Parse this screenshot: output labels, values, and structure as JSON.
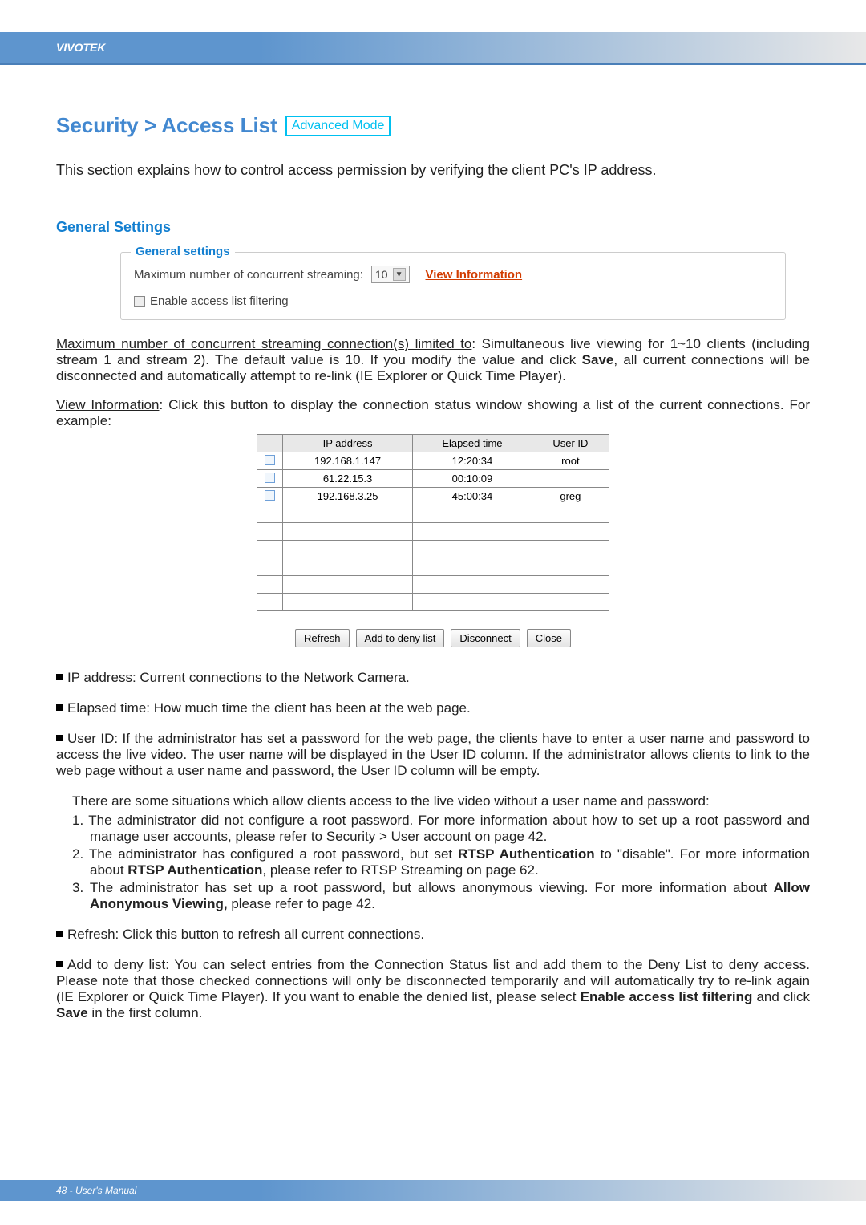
{
  "header": {
    "brand": "VIVOTEK"
  },
  "title": {
    "text": "Security >  Access List",
    "badge": "Advanced Mode"
  },
  "intro": "This section explains how to control access permission by verifying the client PC's IP address.",
  "section": {
    "heading": "General Settings"
  },
  "settings_box": {
    "legend": "General settings",
    "max_label": "Maximum number of concurrent streaming:",
    "max_value": "10",
    "view_info": "View Information",
    "enable_filtering": "Enable access list filtering"
  },
  "para_max": {
    "label": "Maximum number of concurrent streaming connection(s) limited to",
    "text": ": Simultaneous live viewing for 1~10 clients (including stream 1 and stream 2). The default value is 10. If you modify the value and click ",
    "save": "Save",
    "text2": ", all current connections will be disconnected and automatically attempt to re-link (IE Explorer or Quick Time Player)."
  },
  "para_view": {
    "label": "View Information",
    "text": ": Click this button to display the connection status window showing a list of the current connections. For example:"
  },
  "conn_table": {
    "headers": [
      "",
      "IP address",
      "Elapsed time",
      "User ID"
    ],
    "rows": [
      {
        "checked": false,
        "ip": "192.168.1.147",
        "elapsed": "12:20:34",
        "user": "root"
      },
      {
        "checked": false,
        "ip": "61.22.15.3",
        "elapsed": "00:10:09",
        "user": ""
      },
      {
        "checked": false,
        "ip": "192.168.3.25",
        "elapsed": "45:00:34",
        "user": "greg"
      },
      {
        "checked": null,
        "ip": "",
        "elapsed": "",
        "user": ""
      },
      {
        "checked": null,
        "ip": "",
        "elapsed": "",
        "user": ""
      },
      {
        "checked": null,
        "ip": "",
        "elapsed": "",
        "user": ""
      },
      {
        "checked": null,
        "ip": "",
        "elapsed": "",
        "user": ""
      },
      {
        "checked": null,
        "ip": "",
        "elapsed": "",
        "user": ""
      },
      {
        "checked": null,
        "ip": "",
        "elapsed": "",
        "user": ""
      }
    ],
    "buttons": {
      "refresh": "Refresh",
      "add_deny": "Add to deny list",
      "disconnect": "Disconnect",
      "close": "Close"
    }
  },
  "bullets": {
    "ip_addr": "IP address: Current connections to the Network Camera.",
    "elapsed": "Elapsed time: How much time the client has been at the web page.",
    "user_id": {
      "p1": "User ID: If the administrator has set a password for the web page, the clients have to enter a user name and password to access the live video. The user name will be displayed in the User ID column. If  the administrator allows clients to link to the web page without a user name and password, the User ID column will be empty.",
      "p2": "There are some situations which allow clients access to the live video without a user name and password:",
      "n1a": "1. The administrator did not configure a root password. For more information about how to set up a root password and manage user accounts, please refer to Security > User account on page 42.",
      "n2a": "2. The administrator has configured a root password, but set ",
      "n2b": "RTSP Authentication",
      "n2c": " to \"disable\". For more information about ",
      "n2d": "RTSP Authentication",
      "n2e": ", please refer to RTSP Streaming on page 62.",
      "n3a": "3. The administrator has set up a root password, but allows anonymous viewing. For more information about ",
      "n3b": "Allow Anonymous Viewing,",
      "n3c": " please refer to page 42."
    },
    "refresh": "Refresh: Click this button to refresh all current connections.",
    "add_deny_a": "Add to deny list: You can select entries from the Connection Status list and add them to the Deny List to deny access. Please note that those checked connections will only be disconnected temporarily and will automatically try to re-link again (IE Explorer or Quick Time Player). If you want to enable the denied list, please select ",
    "add_deny_b": "Enable access list filtering",
    "add_deny_c": " and click ",
    "add_deny_d": "Save",
    "add_deny_e": " in the first column."
  },
  "footer": {
    "text": "48 - User's Manual"
  }
}
